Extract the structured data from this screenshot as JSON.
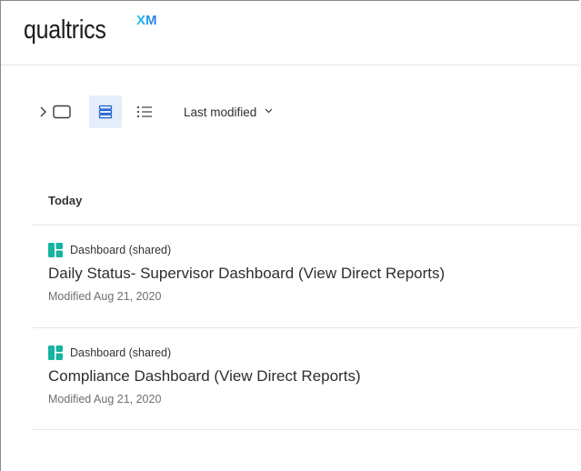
{
  "header": {
    "logo_text": "qualtrics",
    "logo_superscript": "XM"
  },
  "toolbar": {
    "expand_icon": "chevron-right-icon",
    "folder_icon": "folder-icon",
    "card_view_icon": "card-view-icon",
    "list_view_icon": "list-view-icon",
    "sort_label": "Last modified",
    "sort_chevron_icon": "chevron-down-icon"
  },
  "section": {
    "title": "Today"
  },
  "items": [
    {
      "type_label": "Dashboard (shared)",
      "title": "Daily Status- Supervisor Dashboard (View Direct Reports)",
      "modified": "Modified Aug 21, 2020"
    },
    {
      "type_label": "Dashboard (shared)",
      "title": "Compliance Dashboard (View Direct Reports)",
      "modified": "Modified Aug 21, 2020"
    }
  ],
  "colors": {
    "dashboard_icon": "#16b3a1",
    "active_view_bg": "#e4edfa",
    "active_view_icon": "#1f5fd1",
    "logo_xm_start": "#21c6f3",
    "logo_xm_end": "#2a72e8"
  }
}
